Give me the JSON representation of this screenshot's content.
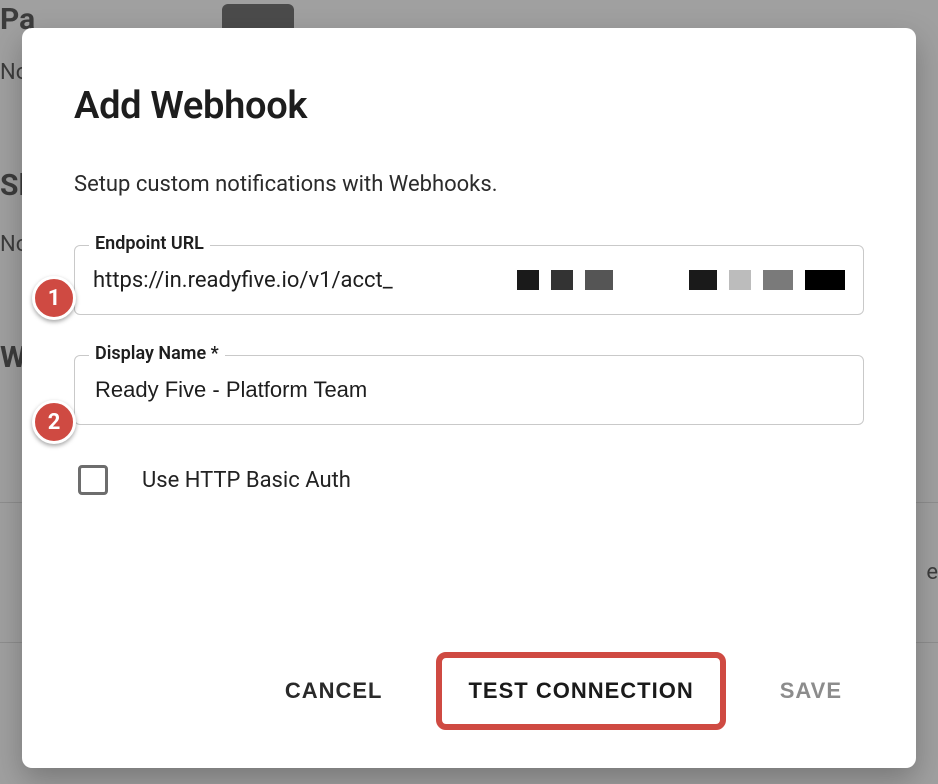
{
  "background": {
    "pager_row_left": "Pa",
    "slack_row_left": "Sl",
    "webhook_row_left": "W",
    "none1": "No",
    "none2": "No",
    "right_fragment": "e"
  },
  "modal": {
    "title": "Add Webhook",
    "subtitle": "Setup custom notifications with Webhooks.",
    "endpoint": {
      "label": "Endpoint URL",
      "value_prefix": "https://in.readyfive.io/v1/acct_"
    },
    "display_name": {
      "label": "Display Name *",
      "value": "Ready Five - Platform Team"
    },
    "basic_auth": {
      "label": "Use HTTP Basic Auth",
      "checked": false
    },
    "actions": {
      "cancel": "CANCEL",
      "test": "TEST CONNECTION",
      "save": "SAVE"
    }
  },
  "callouts": {
    "one": "1",
    "two": "2"
  }
}
